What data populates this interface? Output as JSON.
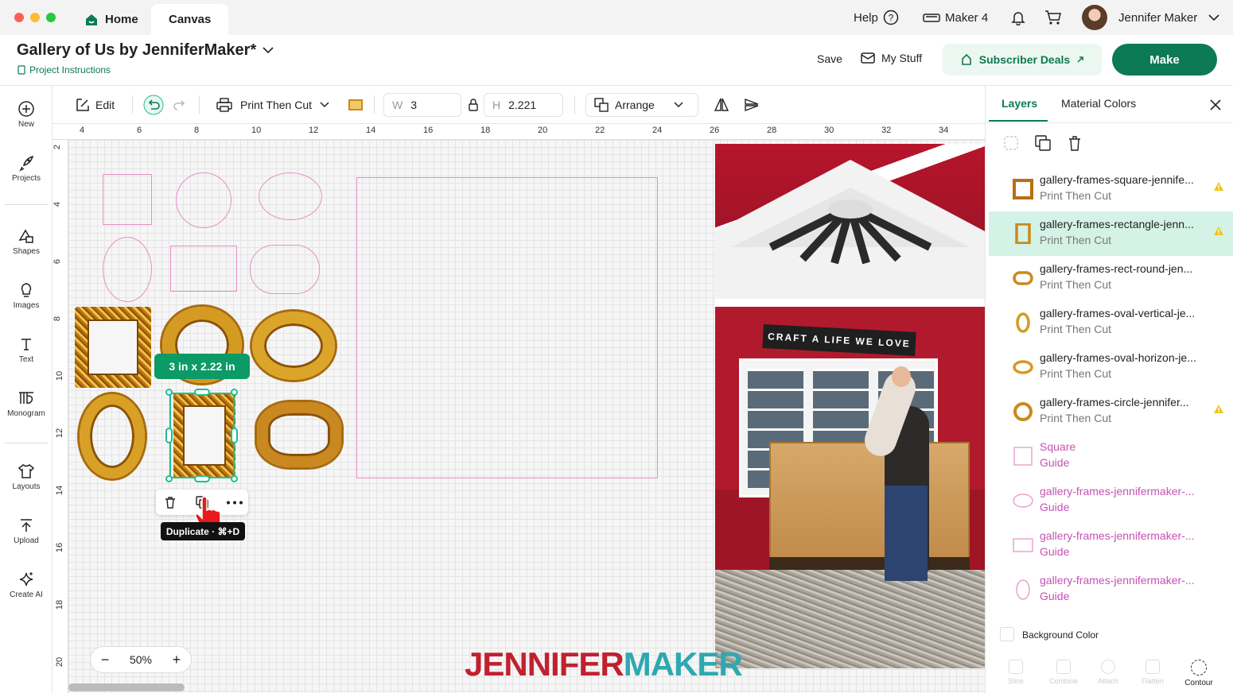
{
  "titlebar": {
    "tabs": [
      "Home",
      "Canvas"
    ],
    "help_label": "Help",
    "machine_label": "Maker 4",
    "user_name": "Jennifer Maker"
  },
  "header": {
    "project_title": "Gallery of Us by JenniferMaker*",
    "project_instructions": "Project Instructions",
    "save_label": "Save",
    "my_stuff_label": "My Stuff",
    "subscriber_deals_label": "Subscriber Deals",
    "make_label": "Make"
  },
  "toolbar": {
    "edit_label": "Edit",
    "operation_label": "Print Then Cut",
    "width_label": "W",
    "width_value": "3",
    "height_label": "H",
    "height_value": "2.221",
    "arrange_label": "Arrange"
  },
  "leftnav": [
    {
      "label": "New",
      "icon": "plus-circle-icon"
    },
    {
      "label": "Projects",
      "icon": "rocket-icon"
    },
    {
      "label": "Shapes",
      "icon": "shapes-icon"
    },
    {
      "label": "Images",
      "icon": "lightbulb-icon"
    },
    {
      "label": "Text",
      "icon": "text-icon"
    },
    {
      "label": "Monogram",
      "icon": "monogram-icon"
    },
    {
      "label": "Layouts",
      "icon": "shirt-icon"
    },
    {
      "label": "Upload",
      "icon": "upload-icon"
    },
    {
      "label": "Create AI",
      "icon": "sparkle-icon"
    }
  ],
  "ruler": {
    "top_ticks": [
      "4",
      "6",
      "8",
      "10",
      "12",
      "14",
      "16",
      "18",
      "20",
      "22",
      "24",
      "26",
      "28",
      "30",
      "32",
      "34"
    ],
    "left_ticks": [
      "2",
      "4",
      "6",
      "8",
      "10",
      "12",
      "14",
      "16",
      "18",
      "20"
    ]
  },
  "canvas": {
    "size_badge": "3 in x 2.22 in",
    "tooltip": "Duplicate · ⌘+D",
    "zoom": "50%",
    "photo_sign": "CRAFT A LIFE WE LOVE",
    "watermark_left": "JENNIFER",
    "watermark_right": "MAKER"
  },
  "rightpanel": {
    "tabs": [
      "Layers",
      "Material Colors"
    ],
    "layers": [
      {
        "name": "gallery-frames-square-jennife...",
        "sub": "Print Then Cut",
        "kind": "square",
        "warn": true,
        "selected": false,
        "guide": false
      },
      {
        "name": "gallery-frames-rectangle-jenn...",
        "sub": "Print Then Cut",
        "kind": "rect",
        "warn": true,
        "selected": true,
        "guide": false
      },
      {
        "name": "gallery-frames-rect-round-jen...",
        "sub": "Print Then Cut",
        "kind": "round",
        "warn": false,
        "selected": false,
        "guide": false
      },
      {
        "name": "gallery-frames-oval-vertical-je...",
        "sub": "Print Then Cut",
        "kind": "ovalv",
        "warn": false,
        "selected": false,
        "guide": false
      },
      {
        "name": "gallery-frames-oval-horizon-je...",
        "sub": "Print Then Cut",
        "kind": "ovalh",
        "warn": false,
        "selected": false,
        "guide": false
      },
      {
        "name": "gallery-frames-circle-jennifer...",
        "sub": "Print Then Cut",
        "kind": "circle",
        "warn": true,
        "selected": false,
        "guide": false
      },
      {
        "name": "Square",
        "sub": "Guide",
        "kind": "gsquare",
        "warn": false,
        "selected": false,
        "guide": true
      },
      {
        "name": "gallery-frames-jennifermaker-...",
        "sub": "Guide",
        "kind": "goval",
        "warn": false,
        "selected": false,
        "guide": true
      },
      {
        "name": "gallery-frames-jennifermaker-...",
        "sub": "Guide",
        "kind": "grect",
        "warn": false,
        "selected": false,
        "guide": true
      },
      {
        "name": "gallery-frames-jennifermaker-...",
        "sub": "Guide",
        "kind": "govalv",
        "warn": false,
        "selected": false,
        "guide": true
      }
    ],
    "background_color_label": "Background Color",
    "bottom_actions": [
      "Slice",
      "Combine",
      "Attach",
      "Flatten",
      "Contour"
    ]
  },
  "colors": {
    "brand_green": "#0c7a54",
    "selection_teal": "#1fbf8f",
    "guide_pink": "#e58fc6",
    "selected_layer_bg": "#d4f2e6",
    "warning_yellow": "#f2c31b"
  }
}
